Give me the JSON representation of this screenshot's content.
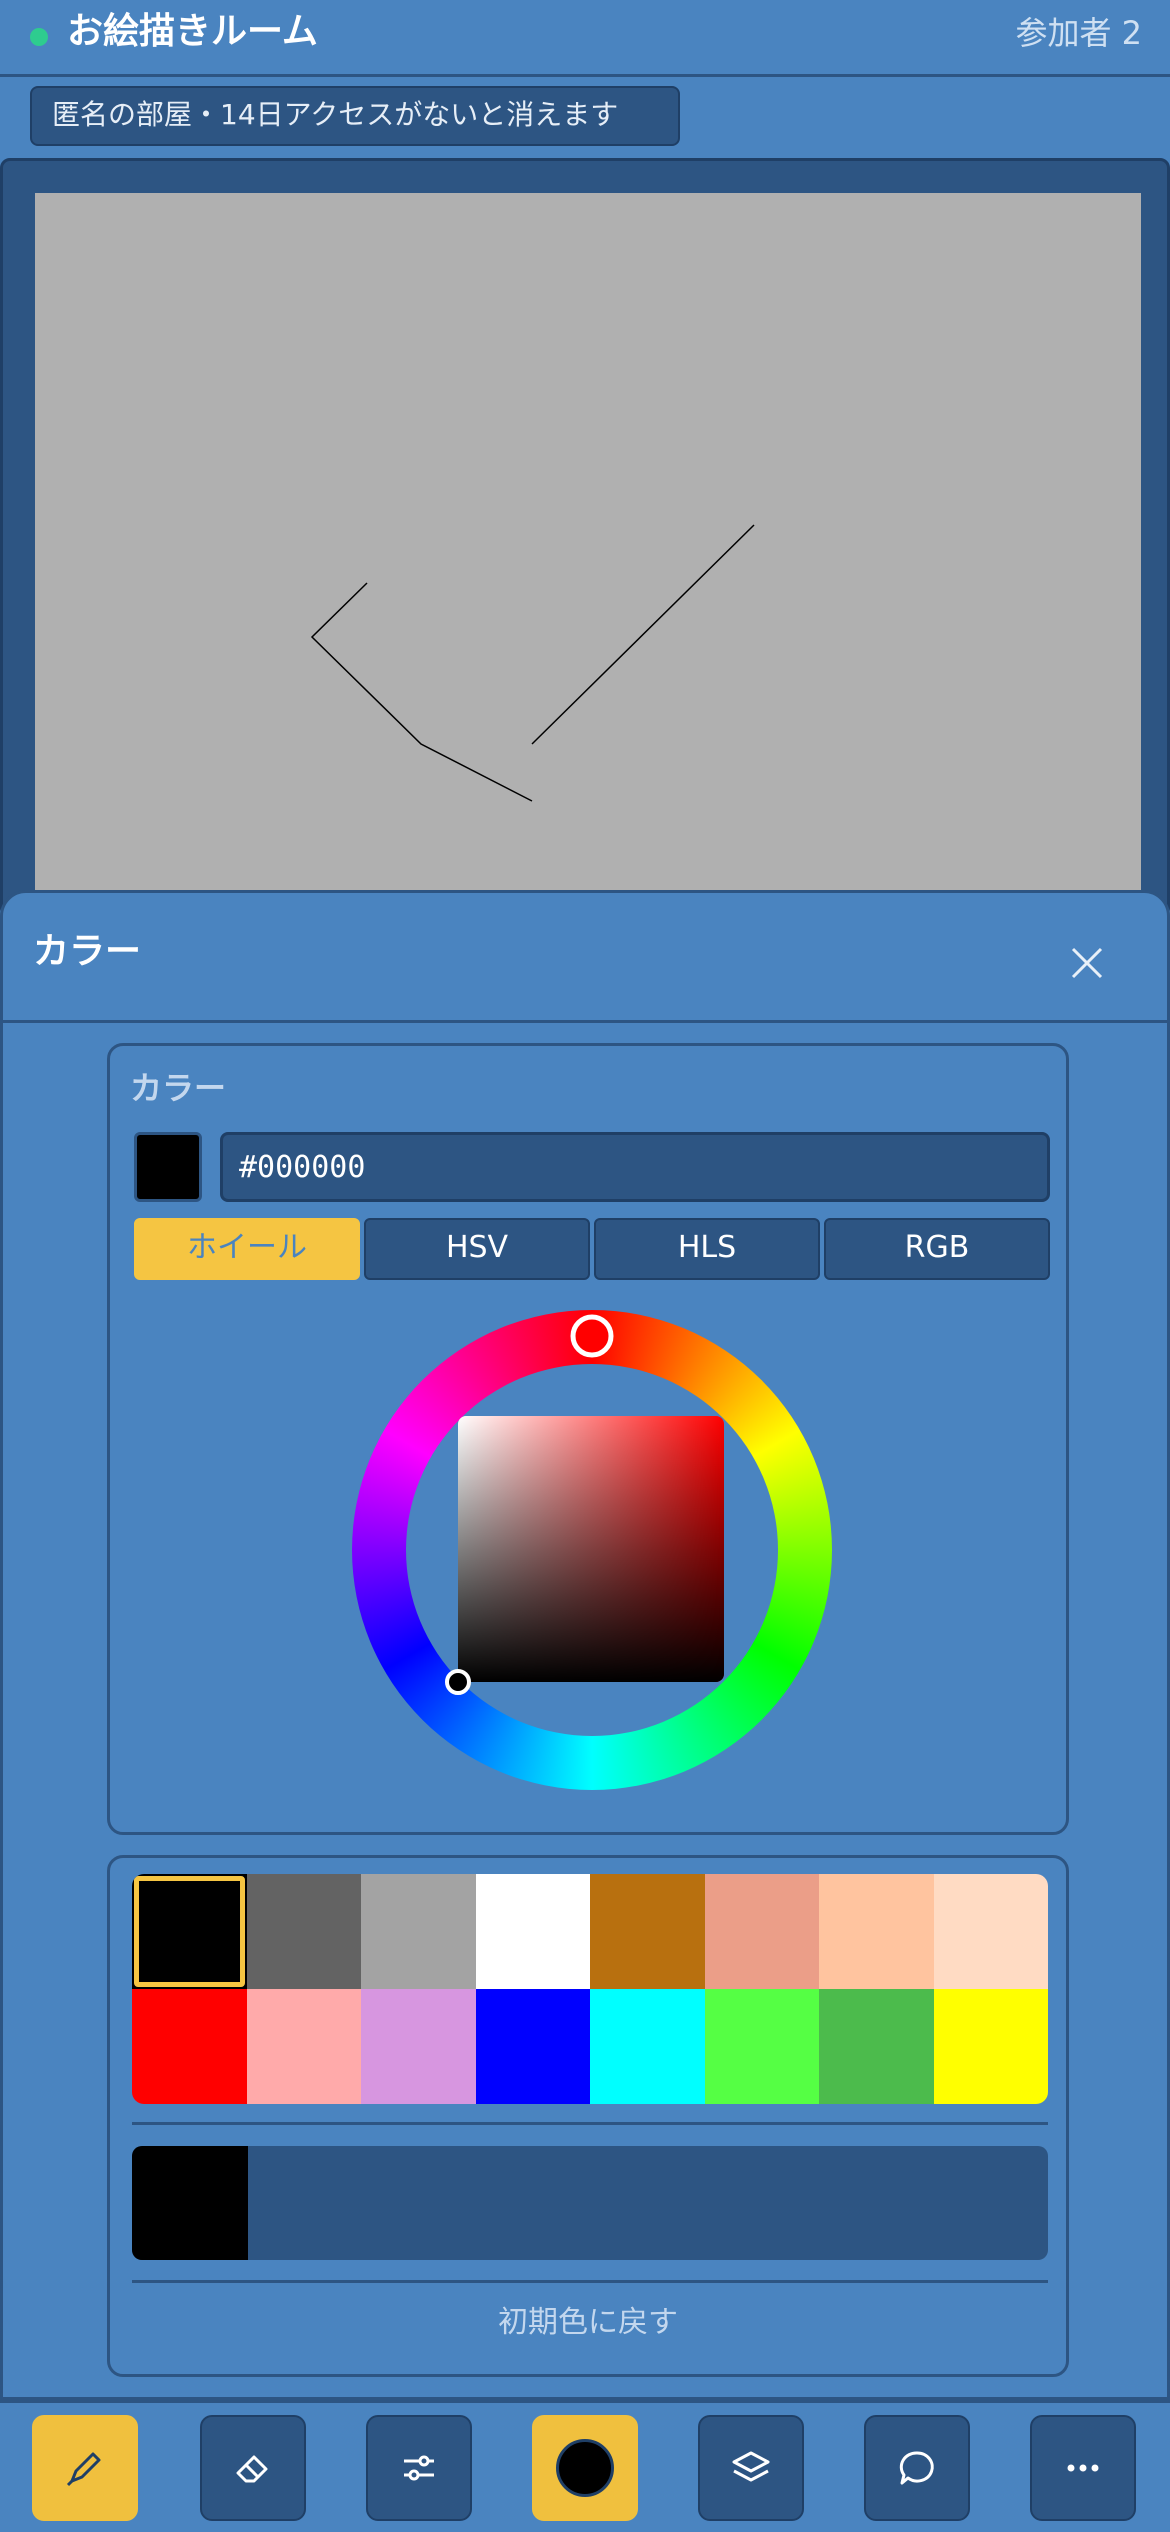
{
  "header": {
    "title": "お絵描きルーム",
    "participants": "参加者 2",
    "status_color": "#2ecc8f"
  },
  "notice": "匿名の部屋・14日アクセスがないと消えます",
  "canvas": {
    "background": "#b0b0b0",
    "stroke_color": "#000000"
  },
  "color_sheet": {
    "title": "カラー",
    "close_icon": "close-icon",
    "picker": {
      "label": "カラー",
      "current_color": "#000000",
      "hex_value": "#000000",
      "tabs": [
        "ホイール",
        "HSV",
        "HLS",
        "RGB"
      ],
      "active_tab": "ホイール",
      "hue_marker_color": "#ff0000"
    },
    "palette": {
      "colors": [
        "#000000",
        "#636363",
        "#a3a3a3",
        "#ffffff",
        "#b8700f",
        "#eb9e88",
        "#ffc49f",
        "#ffdbc3",
        "#ff0000",
        "#ffaaaa",
        "#d796e0",
        "#0000ff",
        "#00ffff",
        "#55ff44",
        "#4cbb4c",
        "#ffff00"
      ],
      "selected_index": 0,
      "history": [
        "#000000"
      ],
      "reset_label": "初期色に戻す"
    }
  },
  "toolbar": {
    "tools": [
      {
        "icon": "pen-icon",
        "active": true
      },
      {
        "icon": "eraser-icon",
        "active": false
      },
      {
        "icon": "sliders-icon",
        "active": false
      },
      {
        "icon": "color-icon",
        "active": true
      },
      {
        "icon": "layers-icon",
        "active": false
      },
      {
        "icon": "chat-icon",
        "active": false
      },
      {
        "icon": "more-icon",
        "active": false
      }
    ],
    "accent": "#f0c03e"
  }
}
